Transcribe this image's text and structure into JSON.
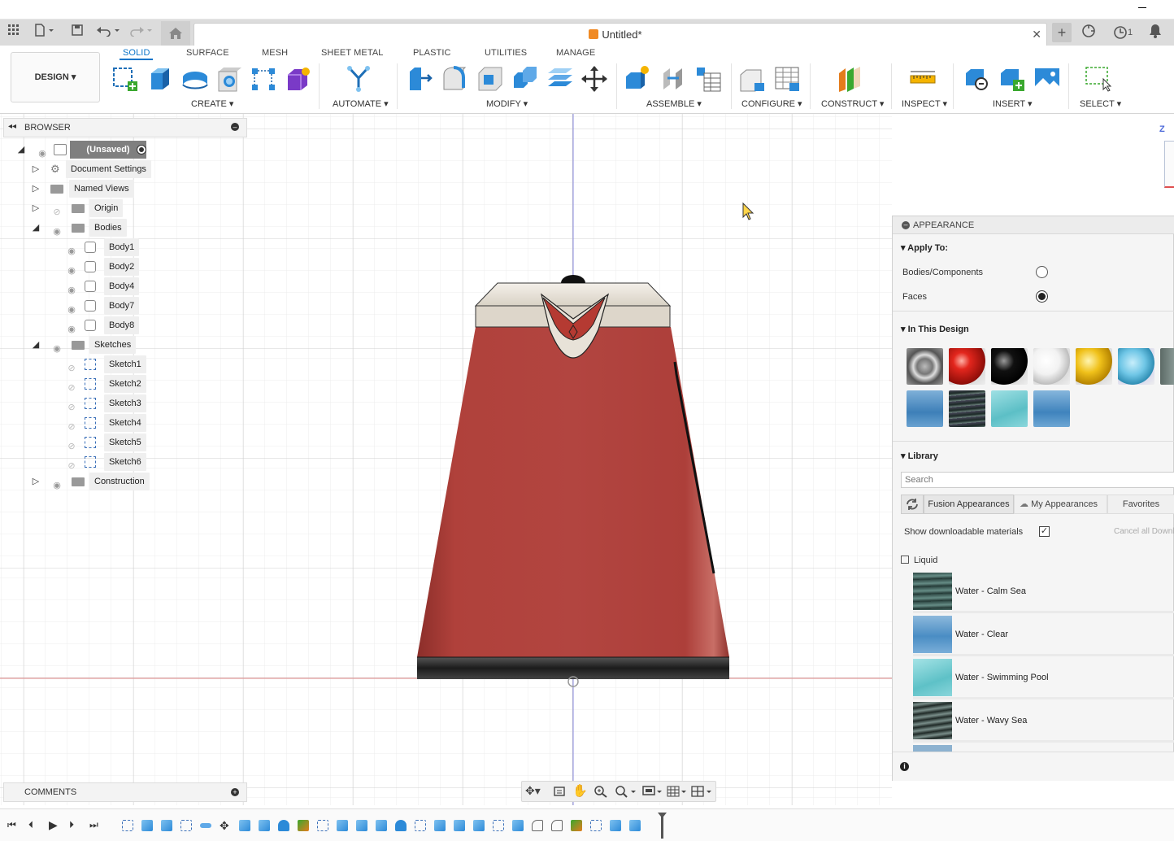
{
  "document": {
    "title": "Untitled*",
    "notification_count": "1"
  },
  "workspace": {
    "label": "DESIGN"
  },
  "tabs": [
    {
      "label": "SOLID",
      "active": true
    },
    {
      "label": "SURFACE"
    },
    {
      "label": "MESH"
    },
    {
      "label": "SHEET METAL"
    },
    {
      "label": "PLASTIC"
    },
    {
      "label": "UTILITIES"
    },
    {
      "label": "MANAGE"
    }
  ],
  "groups": {
    "create": "CREATE",
    "automate": "AUTOMATE",
    "modify": "MODIFY",
    "assemble": "ASSEMBLE",
    "configure": "CONFIGURE",
    "construct": "CONSTRUCT",
    "inspect": "INSPECT",
    "insert": "INSERT",
    "select": "SELECT"
  },
  "browser": {
    "title": "BROWSER",
    "root": "(Unsaved)",
    "items": {
      "document_settings": "Document Settings",
      "named_views": "Named Views",
      "origin": "Origin",
      "bodies": "Bodies",
      "sketches": "Sketches",
      "construction": "Construction"
    },
    "bodies": [
      "Body1",
      "Body2",
      "Body4",
      "Body7",
      "Body8"
    ],
    "sketches": [
      "Sketch1",
      "Sketch2",
      "Sketch3",
      "Sketch4",
      "Sketch5",
      "Sketch6"
    ]
  },
  "comments": {
    "title": "COMMENTS"
  },
  "viewcube": {
    "axis": "Z"
  },
  "appearance": {
    "title": "APPEARANCE",
    "apply_to": "Apply To:",
    "bodies_components": "Bodies/Components",
    "faces": "Faces",
    "selected": "faces",
    "in_this_design": "In This Design",
    "library": "Library",
    "search_placeholder": "Search",
    "lib_tabs": [
      "Fusion Appearances",
      "My Appearances",
      "Favorites"
    ],
    "show_downloadable": "Show downloadable materials",
    "show_downloadable_checked": true,
    "cancel_downloads": "Cancel all Downl",
    "category": "Liquid",
    "materials": [
      "Water - Calm Sea",
      "Water - Clear",
      "Water - Swimming Pool",
      "Water - Wavy Sea"
    ]
  },
  "colors": {
    "accent": "#0a74c9",
    "kettle_body": "#b0413b",
    "kettle_base": "#2a2a2a",
    "lid": "#e9e4dc"
  }
}
